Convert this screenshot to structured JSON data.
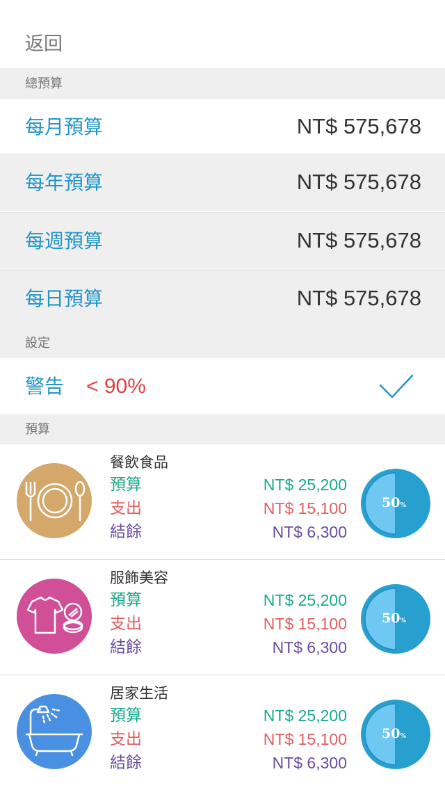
{
  "nav": {
    "back_label": "返回"
  },
  "sections": {
    "total_budget": "總預算",
    "settings": "設定",
    "budget": "預算"
  },
  "budget_rows": [
    {
      "label": "每月預算",
      "amount": "NT$ 575,678"
    },
    {
      "label": "每年預算",
      "amount": "NT$ 575,678"
    },
    {
      "label": "每週預算",
      "amount": "NT$ 575,678"
    },
    {
      "label": "每日預算",
      "amount": "NT$ 575,678"
    }
  ],
  "warning": {
    "label": "警告",
    "value": "< 90%",
    "checked": true
  },
  "categories": [
    {
      "name": "餐飲食品",
      "icon": "dining-icon",
      "color": "#d4a86a",
      "budget_label": "預算",
      "budget": "NT$ 25,200",
      "spent_label": "支出",
      "spent": "NT$ 15,100",
      "balance_label": "結餘",
      "balance": "NT$ 6,300",
      "percent": 50,
      "percent_text": "50",
      "percent_unit": "%"
    },
    {
      "name": "服飾美容",
      "icon": "tshirt-compact-icon",
      "color": "#d14f96",
      "budget_label": "預算",
      "budget": "NT$ 25,200",
      "spent_label": "支出",
      "spent": "NT$ 15,100",
      "balance_label": "結餘",
      "balance": "NT$ 6,300",
      "percent": 50,
      "percent_text": "50",
      "percent_unit": "%"
    },
    {
      "name": "居家生活",
      "icon": "bathtub-shower-icon",
      "color": "#4a90e2",
      "budget_label": "預算",
      "budget": "NT$ 25,200",
      "spent_label": "支出",
      "spent": "NT$ 15,100",
      "balance_label": "結餘",
      "balance": "NT$ 6,300",
      "percent": 50,
      "percent_text": "50",
      "percent_unit": "%"
    }
  ],
  "colors": {
    "accent": "#2196c8",
    "warning": "#e0413f",
    "budget": "#19a98c",
    "spent": "#e35d5e",
    "balance": "#6a4c9e",
    "pie_dark": "#27a0cf",
    "pie_light": "#6fc8f2"
  }
}
